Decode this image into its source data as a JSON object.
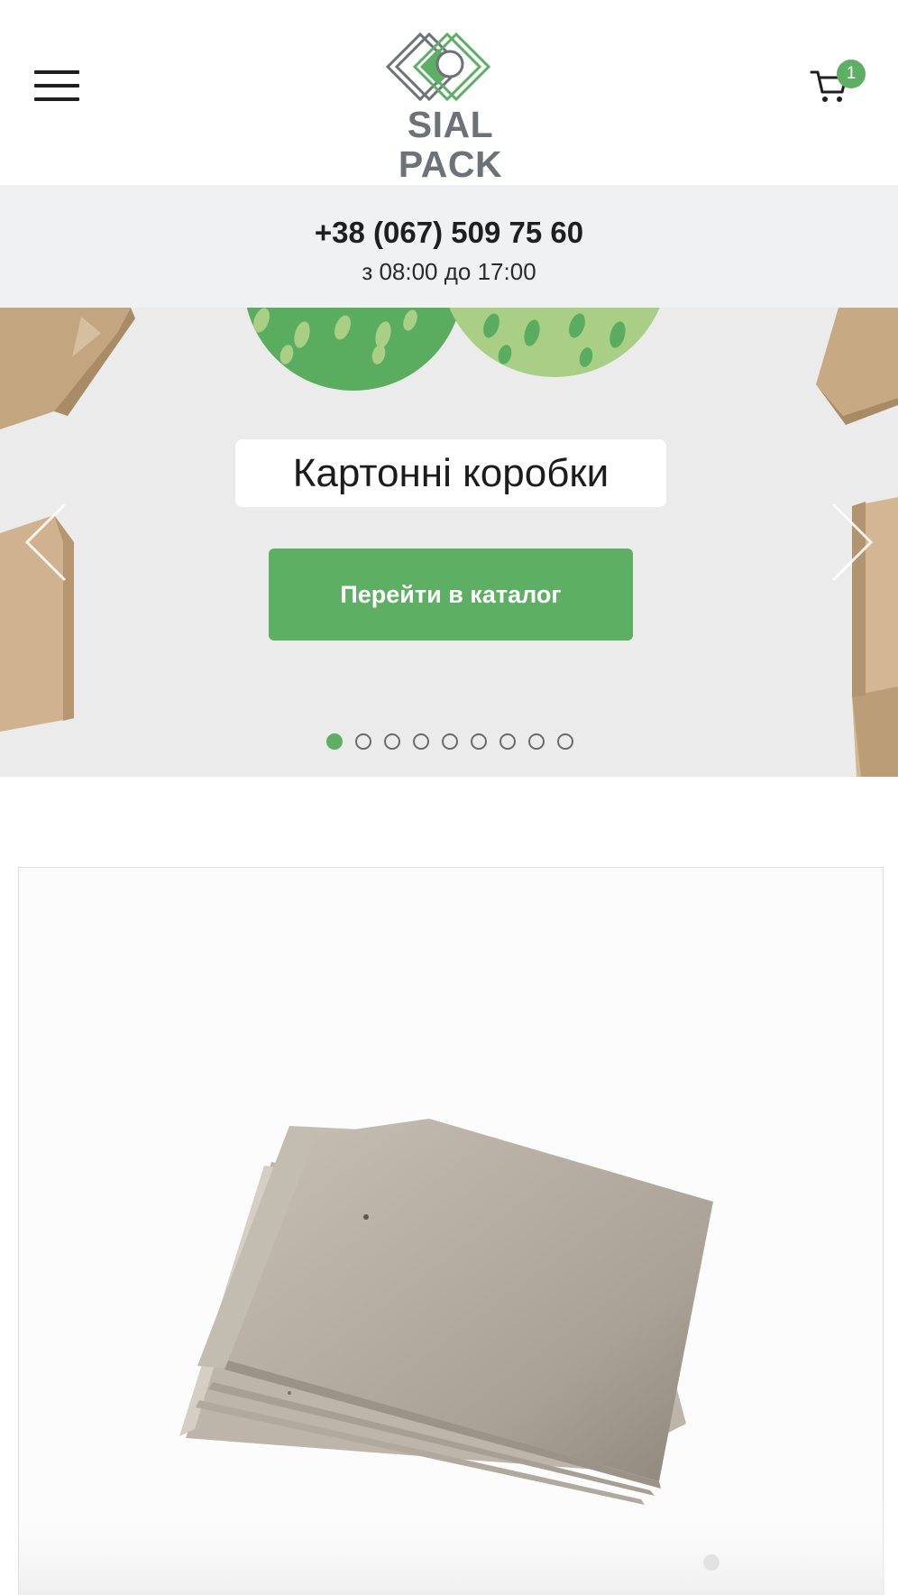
{
  "header": {
    "menu_icon": "hamburger-menu-icon",
    "logo": {
      "text": "SIAL PACK",
      "colors": {
        "green": "#5daf63",
        "gray": "#6d7278"
      }
    },
    "cart": {
      "icon": "cart-icon",
      "count": "1"
    }
  },
  "contact": {
    "phone": "+38 (067) 509 75 60",
    "hours": "з 08:00 до 17:00"
  },
  "slider": {
    "title": "Картонні коробки",
    "button_label": "Перейти в каталог",
    "prev_icon": "chevron-left-icon",
    "next_icon": "chevron-right-icon",
    "slide_count": 9,
    "active_slide": 1
  },
  "product": {
    "image": "cardboard-sheets-image"
  },
  "colors": {
    "accent": "#5daf63",
    "contact_bg": "#f0f1f2",
    "slider_bg": "#ebebec"
  }
}
